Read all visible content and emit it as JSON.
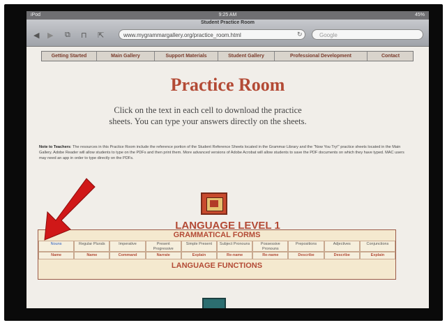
{
  "status": {
    "device": "iPod",
    "time": "9:25 AM",
    "battery": "45%"
  },
  "browser": {
    "page_title": "Student Practice Room",
    "url": "www.mygrammargallery.org/practice_room.html",
    "search_placeholder": "Google"
  },
  "menu": [
    "Getting Started",
    "Main Gallery",
    "Support Materials",
    "Student Gallery",
    "Professional Development",
    "Contact"
  ],
  "page": {
    "title": "Practice Room",
    "intro": "Click on the text in each cell to download the practice sheets. You can type your answers directly on the sheets.",
    "note_label": "Note to Teachers",
    "note_text": ": The resources in this Practice Room include the reference portion of the Student Reference Sheets located in the Grammar Library and the \"Now You Try!\" practice sheets located in the Main Gallery. Adobe Reader will allow students to type on the PDFs and then print them. More advanced versions of Adobe Acrobat will allow students to save the PDF documents on which they have typed. MAC users may need an app in order to type directly on the PDFs.",
    "level": "LANGUAGE LEVEL 1",
    "table_title": "GRAMMATICAL FORMS",
    "forms": [
      "Nouns",
      "Regular Plurals",
      "Imperative",
      "Present Progressive",
      "Simple Present",
      "Subject Pronouns",
      "Possessive Pronouns",
      "Prepositions",
      "Adjectives",
      "Conjunctions"
    ],
    "actions": [
      "Name",
      "Name",
      "Command",
      "Narrate",
      "Explain",
      "Re-name",
      "Re-name",
      "Describe",
      "Describe",
      "Explain"
    ],
    "functions_title": "LANGUAGE FUNCTIONS"
  },
  "colors": {
    "accent": "#b34a35",
    "arrow": "#d01818",
    "frame": "#0a0a0a"
  }
}
